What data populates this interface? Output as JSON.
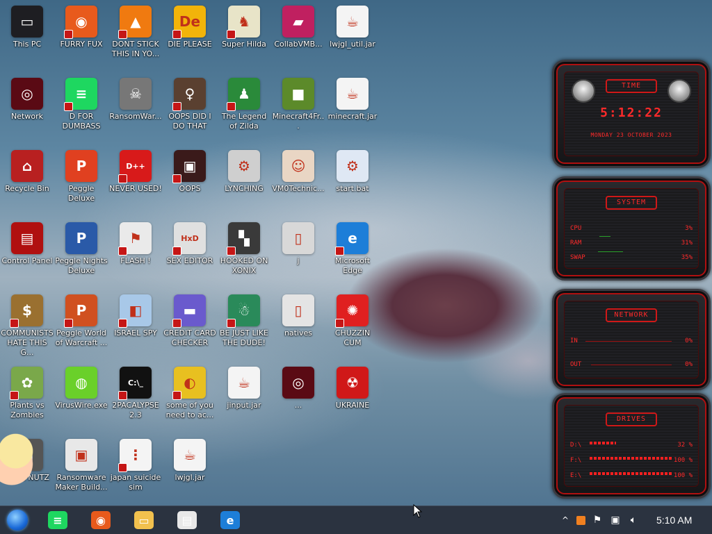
{
  "desktop_icons": [
    {
      "label": "This PC",
      "color": "#1e1e22",
      "glyph": "▭",
      "badge": false
    },
    {
      "label": "FURRY FUX",
      "color": "#e85a1c",
      "glyph": "◉",
      "badge": true
    },
    {
      "label": "DONT STICK THIS IN YO...",
      "color": "#f07a10",
      "glyph": "▲",
      "badge": true
    },
    {
      "label": "DIE PLEASE",
      "color": "#f2b40a",
      "glyph": "De",
      "badge": true
    },
    {
      "label": "Super Hilda",
      "color": "#e8e4c8",
      "glyph": "♞",
      "badge": true
    },
    {
      "label": "CollabVMB...",
      "color": "#c02060",
      "glyph": "▰",
      "badge": false
    },
    {
      "label": "lwjgl_util.jar",
      "color": "#f4f4f4",
      "glyph": "☕",
      "badge": false
    },
    {
      "label": "Network",
      "color": "#5a0a14",
      "glyph": "◎",
      "badge": false
    },
    {
      "label": "D FOR DUMBASS",
      "color": "#1ed760",
      "glyph": "≡",
      "badge": true
    },
    {
      "label": "RansomWar...",
      "color": "#777777",
      "glyph": "☠",
      "badge": false
    },
    {
      "label": "OOPS DID I DO THAT",
      "color": "#5a4030",
      "glyph": "♀",
      "badge": true
    },
    {
      "label": "The Legend of Zilda",
      "color": "#2a8a3a",
      "glyph": "♟",
      "badge": true
    },
    {
      "label": "Minecraft4Fr...",
      "color": "#5c8a2a",
      "glyph": "■",
      "badge": false
    },
    {
      "label": "minecraft.jar",
      "color": "#f4f4f4",
      "glyph": "☕",
      "badge": false
    },
    {
      "label": "Recycle Bin",
      "color": "#b82020",
      "glyph": "⌂",
      "badge": false
    },
    {
      "label": "Peggle Deluxe",
      "color": "#e04020",
      "glyph": "P",
      "badge": false
    },
    {
      "label": "NEVER USED!",
      "color": "#d81a1a",
      "glyph": "D++",
      "badge": true
    },
    {
      "label": "OOPS",
      "color": "#3a1a1a",
      "glyph": "▣",
      "badge": true
    },
    {
      "label": "LYNCHING",
      "color": "#cfcfcf",
      "glyph": "⚙",
      "badge": false
    },
    {
      "label": "VM0Technic...",
      "color": "#e9d6c4",
      "glyph": "☺",
      "badge": false
    },
    {
      "label": "start.bat",
      "color": "#dfe8f4",
      "glyph": "⚙",
      "badge": false
    },
    {
      "label": "Control Panel",
      "color": "#b01010",
      "glyph": "▤",
      "badge": false
    },
    {
      "label": "Peggle Nights Deluxe",
      "color": "#2a5aa8",
      "glyph": "P",
      "badge": false
    },
    {
      "label": "FLASH !",
      "color": "#eaeaea",
      "glyph": "⚑",
      "badge": true
    },
    {
      "label": "SEX EDITOR",
      "color": "#e0e0e0",
      "glyph": "HxD",
      "badge": true
    },
    {
      "label": "HOOKED ON XONIX",
      "color": "#3a3a3a",
      "glyph": "▚",
      "badge": true
    },
    {
      "label": "j",
      "color": "#d8d8d8",
      "glyph": "▯",
      "badge": false
    },
    {
      "label": "Microsoft Edge",
      "color": "#1d7ed8",
      "glyph": "e",
      "badge": true
    },
    {
      "label": "COMMUNISTS HATE THIS G...",
      "color": "#9a7030",
      "glyph": "$",
      "badge": true
    },
    {
      "label": "Peggle World of Warcraft ...",
      "color": "#d05020",
      "glyph": "P",
      "badge": true
    },
    {
      "label": "ISRAEL SPY",
      "color": "#a8c8e8",
      "glyph": "◧",
      "badge": true
    },
    {
      "label": "CREDIT CARD CHECKER",
      "color": "#6a5acd",
      "glyph": "▬",
      "badge": true
    },
    {
      "label": "BE JUST LIKE THE DUDE!",
      "color": "#2a8a5a",
      "glyph": "☃",
      "badge": true
    },
    {
      "label": "natives",
      "color": "#e4e4e4",
      "glyph": "▯",
      "badge": false
    },
    {
      "label": "CHUZZIN CUM",
      "color": "#e02020",
      "glyph": "✺",
      "badge": true
    },
    {
      "label": "Plants vs Zombies",
      "color": "#7aa84a",
      "glyph": "✿",
      "badge": true
    },
    {
      "label": "VirusWire.exe",
      "color": "#6ad02a",
      "glyph": "◍",
      "badge": false
    },
    {
      "label": "2PACALYPSE 2.3",
      "color": "#111111",
      "glyph": "C:\\_",
      "badge": true
    },
    {
      "label": "some of you need to ac...",
      "color": "#e8c020",
      "glyph": "◐",
      "badge": true
    },
    {
      "label": "jinput.jar",
      "color": "#f4f4f4",
      "glyph": "☕",
      "badge": false
    },
    {
      "label": "...",
      "color": "#5a0a14",
      "glyph": "◎",
      "badge": false
    },
    {
      "label": "UKRAINE",
      "color": "#d01818",
      "glyph": "☢",
      "badge": false
    },
    {
      "label": "DEEZ NUTZ",
      "color": "#555555",
      "glyph": "▦",
      "badge": true
    },
    {
      "label": "Ransomware Maker Build...",
      "color": "#e8e8e8",
      "glyph": "▣",
      "badge": false
    },
    {
      "label": "japan suicide sim",
      "color": "#f4f4f4",
      "glyph": "⋮",
      "badge": true
    },
    {
      "label": "lwjgl.jar",
      "color": "#f4f4f4",
      "glyph": "☕",
      "badge": false
    }
  ],
  "widgets": {
    "time": {
      "title": "TIME",
      "clock": "5:12:22",
      "date": "MONDAY 23 OCTOBER 2023"
    },
    "system": {
      "title": "SYSTEM",
      "rows": [
        {
          "k": "CPU",
          "v": "3%"
        },
        {
          "k": "RAM",
          "v": "31%"
        },
        {
          "k": "SWAP",
          "v": "35%"
        }
      ]
    },
    "network": {
      "title": "NETWORK",
      "rows": [
        {
          "k": "IN",
          "v": "0%"
        },
        {
          "k": "OUT",
          "v": "0%"
        }
      ]
    },
    "drives": {
      "title": "DRIVES",
      "rows": [
        {
          "k": "D:\\",
          "v": "32 %",
          "fill": 0.32
        },
        {
          "k": "F:\\",
          "v": "100 %",
          "fill": 1.0
        },
        {
          "k": "E:\\",
          "v": "100 %",
          "fill": 1.0
        }
      ]
    }
  },
  "taskbar": {
    "start_icon": "start-orb-icon",
    "pinned": [
      {
        "name": "spotify-icon",
        "color": "#1ed760",
        "glyph": "≡"
      },
      {
        "name": "firefox-icon",
        "color": "#e85a1c",
        "glyph": "◉"
      },
      {
        "name": "file-explorer-icon",
        "color": "#f2c14e",
        "glyph": "▭"
      },
      {
        "name": "app-window-icon",
        "color": "#e8e8e8",
        "glyph": "▤"
      },
      {
        "name": "edge-icon",
        "color": "#1d7ed8",
        "glyph": "e"
      }
    ],
    "tray": {
      "chevron": "^",
      "clock": "5:10 AM"
    }
  }
}
